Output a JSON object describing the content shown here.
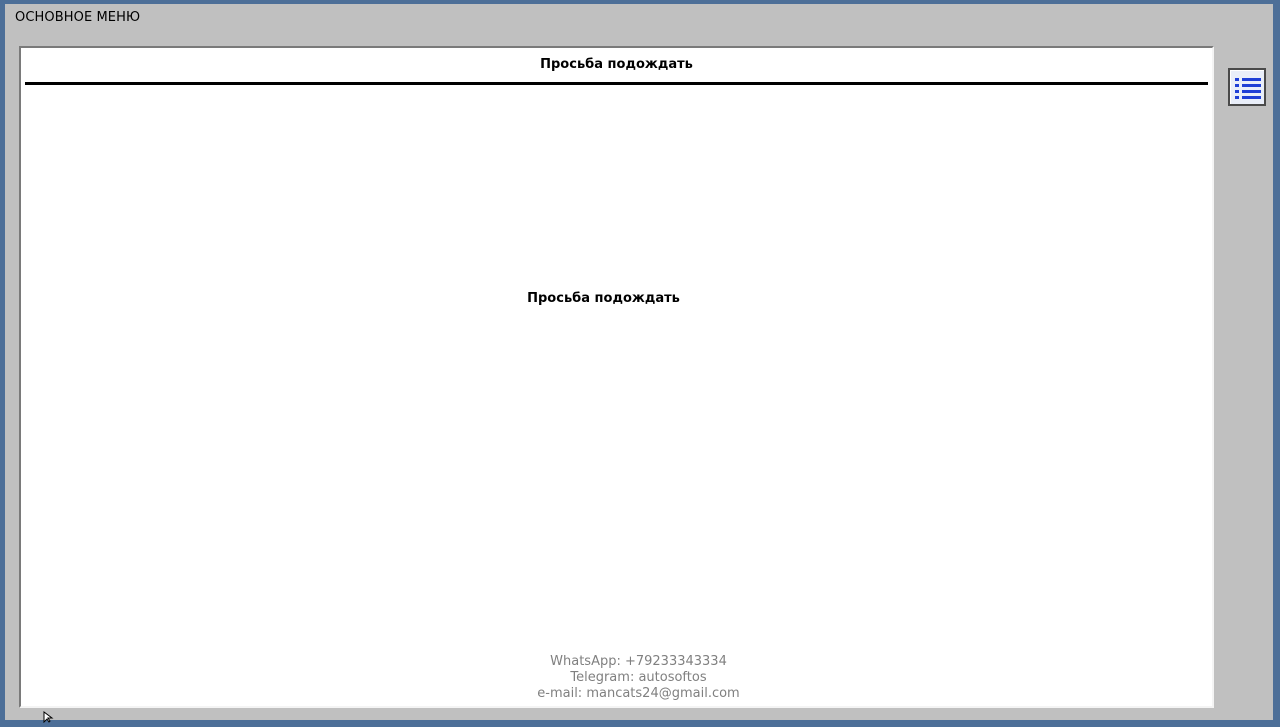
{
  "window": {
    "title": "ОСНОВНОЕ МЕНЮ"
  },
  "panel": {
    "header": "Просьба подождать",
    "message": "Просьба подождать"
  },
  "contacts": {
    "whatsapp": "WhatsApp: +79233343334",
    "telegram": "Telegram: autosoftos",
    "email": "e-mail: mancats24@gmail.com"
  },
  "icons": {
    "menu": "list-icon",
    "pointer": "mouse-pointer-icon"
  },
  "colors": {
    "desktop": "#4d6f98",
    "window_bg": "#c0c0c0",
    "panel_bg": "#ffffff",
    "menu_icon": "#1f3fd6",
    "contact_text": "#808080"
  }
}
